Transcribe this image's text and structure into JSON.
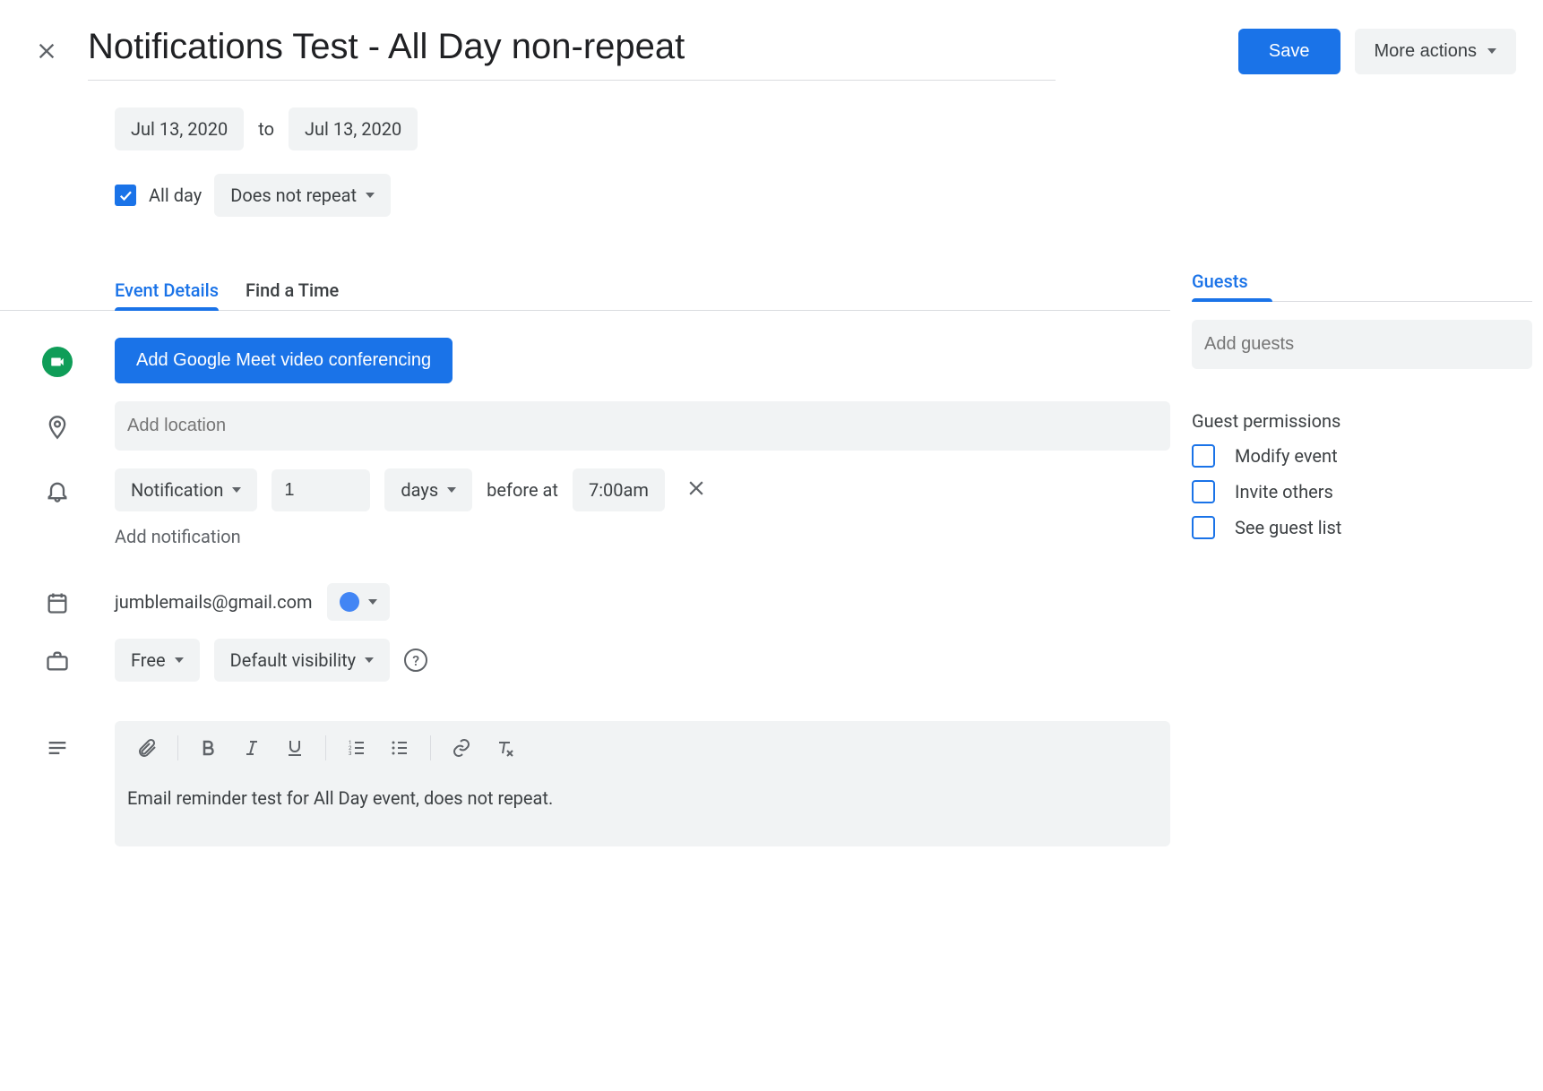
{
  "header": {
    "title": "Notifications Test - All Day non-repeat",
    "save_label": "Save",
    "more_actions_label": "More actions"
  },
  "dates": {
    "start": "Jul 13, 2020",
    "to_label": "to",
    "end": "Jul 13, 2020",
    "all_day_label": "All day",
    "all_day_checked": true,
    "repeat_label": "Does not repeat"
  },
  "tabs": {
    "event_details": "Event Details",
    "find_time": "Find a Time"
  },
  "meet": {
    "button_label": "Add Google Meet video conferencing"
  },
  "location": {
    "placeholder": "Add location",
    "value": ""
  },
  "notification_row": {
    "method": "Notification",
    "count": "1",
    "unit": "days",
    "before_at_label": "before at",
    "time": "7:00am"
  },
  "add_notification_label": "Add notification",
  "calendar": {
    "email": "jumblemails@gmail.com"
  },
  "availability": {
    "status": "Free",
    "visibility": "Default visibility"
  },
  "description": {
    "text": "Email reminder test for All Day event, does not repeat."
  },
  "guests": {
    "header": "Guests",
    "placeholder": "Add guests",
    "permissions_title": "Guest permissions",
    "permissions": [
      {
        "label": "Modify event",
        "checked": false
      },
      {
        "label": "Invite others",
        "checked": false
      },
      {
        "label": "See guest list",
        "checked": false
      }
    ]
  }
}
